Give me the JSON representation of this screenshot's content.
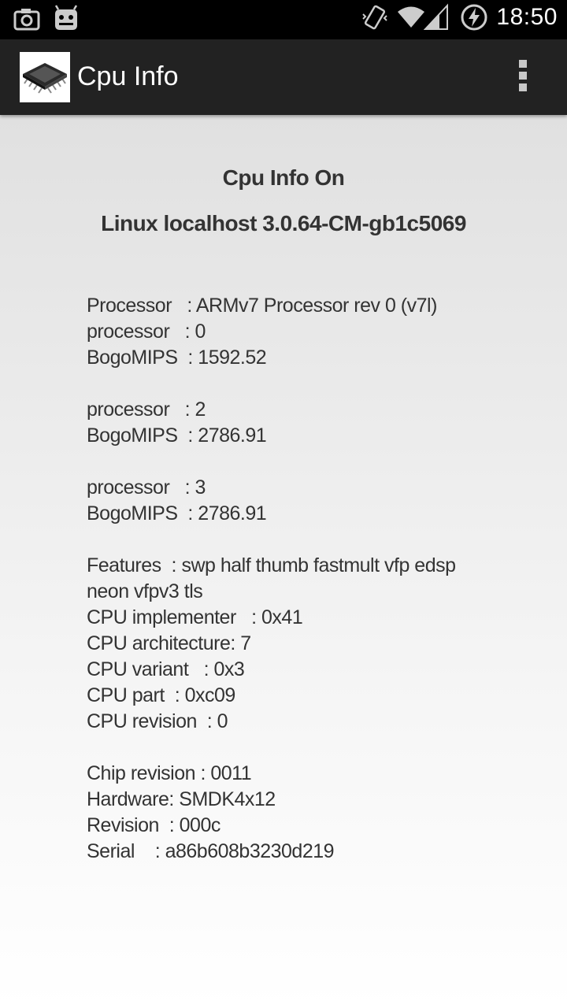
{
  "status_bar": {
    "time": "18:50",
    "icons": [
      "camera-icon",
      "cyanogenmod-android-icon",
      "vibrate-icon",
      "wifi-icon",
      "signal-icon",
      "battery-charging-icon"
    ]
  },
  "action_bar": {
    "title": "Cpu Info",
    "app_icon": "cpu-chip-icon",
    "menu_icon": "overflow-menu-icon"
  },
  "content": {
    "heading_1": "Cpu Info On",
    "heading_2": "Linux localhost 3.0.64-CM-gb1c5069",
    "lines": [
      "Processor   : ARMv7 Processor rev 0 (v7l)",
      "processor   : 0",
      "BogoMIPS  : 1592.52",
      "",
      "processor   : 2",
      "BogoMIPS  : 2786.91",
      "",
      "processor   : 3",
      "BogoMIPS  : 2786.91",
      "",
      "Features  : swp half thumb fastmult vfp edsp",
      "neon vfpv3 tls",
      "CPU implementer   : 0x41",
      "CPU architecture: 7",
      "CPU variant   : 0x3",
      "CPU part  : 0xc09",
      "CPU revision  : 0",
      "",
      "Chip revision : 0011",
      "Hardware: SMDK4x12",
      "Revision  : 000c",
      "Serial    : a86b608b3230d219"
    ]
  }
}
